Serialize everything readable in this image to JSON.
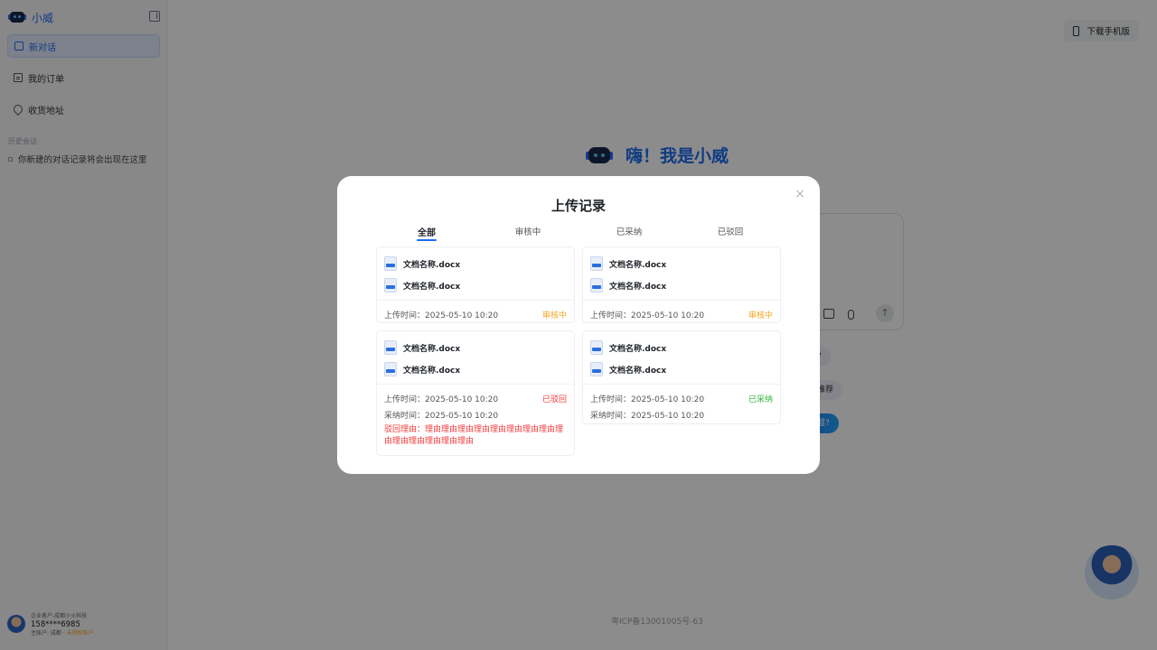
{
  "sidebar": {
    "title": "小威",
    "nav": [
      {
        "label": "新对话"
      },
      {
        "label": "我的订单"
      },
      {
        "label": "收货地址"
      }
    ],
    "history_title": "历史会话",
    "history_empty": "你新建的对话记录将会出现在这里",
    "user": {
      "line1": "企业客户-成都小火科技",
      "phone": "158****6985",
      "line3_prefix": "主账户: 成都 ·",
      "status": "未授权账户"
    }
  },
  "header": {
    "download_label": "下载手机版"
  },
  "hero": {
    "title": "嗨！我是小威"
  },
  "chips": [
    "哪些?",
    "牙刷推荐",
    "么保湿?"
  ],
  "footer": {
    "icp": "粤ICP备13001005号-63"
  },
  "modal": {
    "title": "上传记录",
    "close": "×",
    "tabs": [
      "全部",
      "审核中",
      "已采纳",
      "已驳回"
    ],
    "active_tab": 0,
    "labels": {
      "upload_time": "上传时间：",
      "adopt_time": "采纳时间：",
      "reject_reason": "驳回理由："
    },
    "records": [
      {
        "files": [
          "文档名称.docx",
          "文档名称.docx"
        ],
        "upload_time": "2025-05-10 10:20",
        "status": "审核中",
        "status_key": "pending"
      },
      {
        "files": [
          "文档名称.docx",
          "文档名称.docx"
        ],
        "upload_time": "2025-05-10 10:20",
        "status": "审核中",
        "status_key": "pending"
      },
      {
        "files": [
          "文档名称.docx",
          "文档名称.docx"
        ],
        "upload_time": "2025-05-10 10:20",
        "status": "已驳回",
        "status_key": "rejected",
        "adopt_time": "2025-05-10 10:20",
        "reason": "理由理由理由理由理由理由理由理由理由理由理由理由理由理由"
      },
      {
        "files": [
          "文档名称.docx",
          "文档名称.docx"
        ],
        "upload_time": "2025-05-10 10:20",
        "status": "已采纳",
        "status_key": "accepted",
        "adopt_time": "2025-05-10 10:20"
      }
    ]
  },
  "colors": {
    "accent": "#1d6cf0",
    "pending": "#f5a623",
    "rejected": "#f23c3c",
    "accepted": "#2cb53a"
  }
}
